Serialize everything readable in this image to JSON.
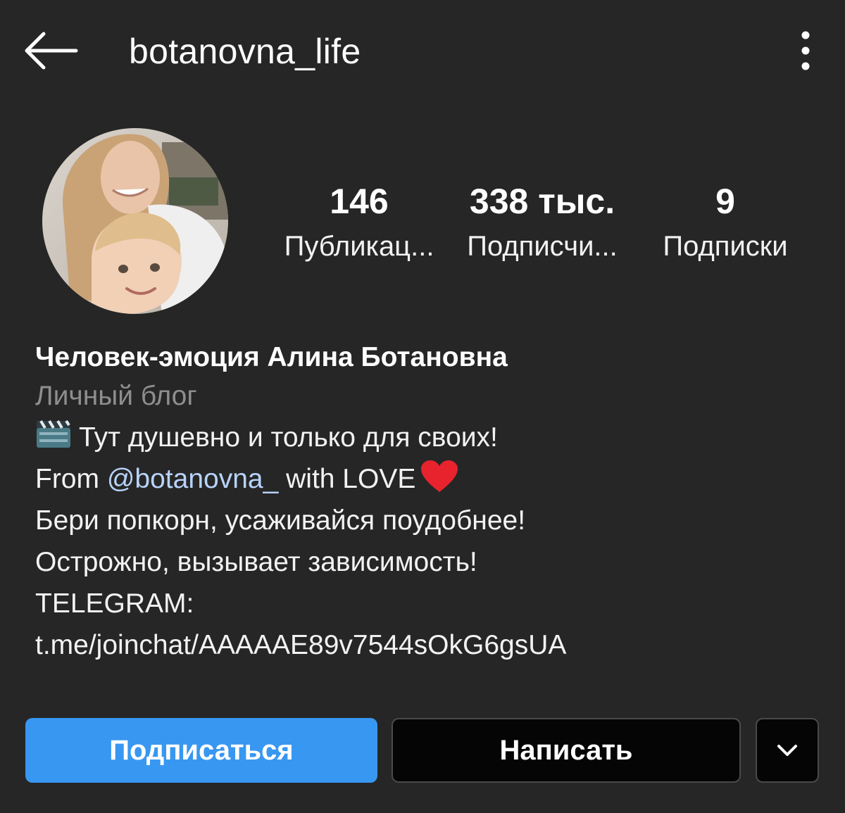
{
  "header": {
    "username": "botanovna_life",
    "back_icon": "arrow-left-icon",
    "menu_icon": "more-vertical-icon"
  },
  "profile": {
    "avatar_alt": "",
    "stats": [
      {
        "value": "146",
        "label": "Публикац..."
      },
      {
        "value": "338 тыс.",
        "label": "Подписчи..."
      },
      {
        "value": "9",
        "label": "Подписки"
      }
    ]
  },
  "bio": {
    "name": "Человек-эмоция Алина Ботановна",
    "category": "Личный блог",
    "line1": "Тут душевно и только для своих!",
    "line2_prefix": "From ",
    "line2_mention": "@botanovna_",
    "line2_suffix": " with LOVE",
    "line3": "Бери попкорн, усаживайся поудобнее!",
    "line4": "Острожно, вызывает зависимость!",
    "line5": "TELEGRAM:",
    "line6": "t.me/joinchat/AAAAAE89v7544sOkG6gsUA"
  },
  "actions": {
    "follow_label": "Подписаться",
    "message_label": "Написать",
    "more_icon": "chevron-down-icon"
  },
  "colors": {
    "background": "#262626",
    "primary_button": "#3897f0",
    "secondary_text": "#8e8e8e",
    "mention": "#b8d3fb",
    "heart": "#e8232d"
  }
}
